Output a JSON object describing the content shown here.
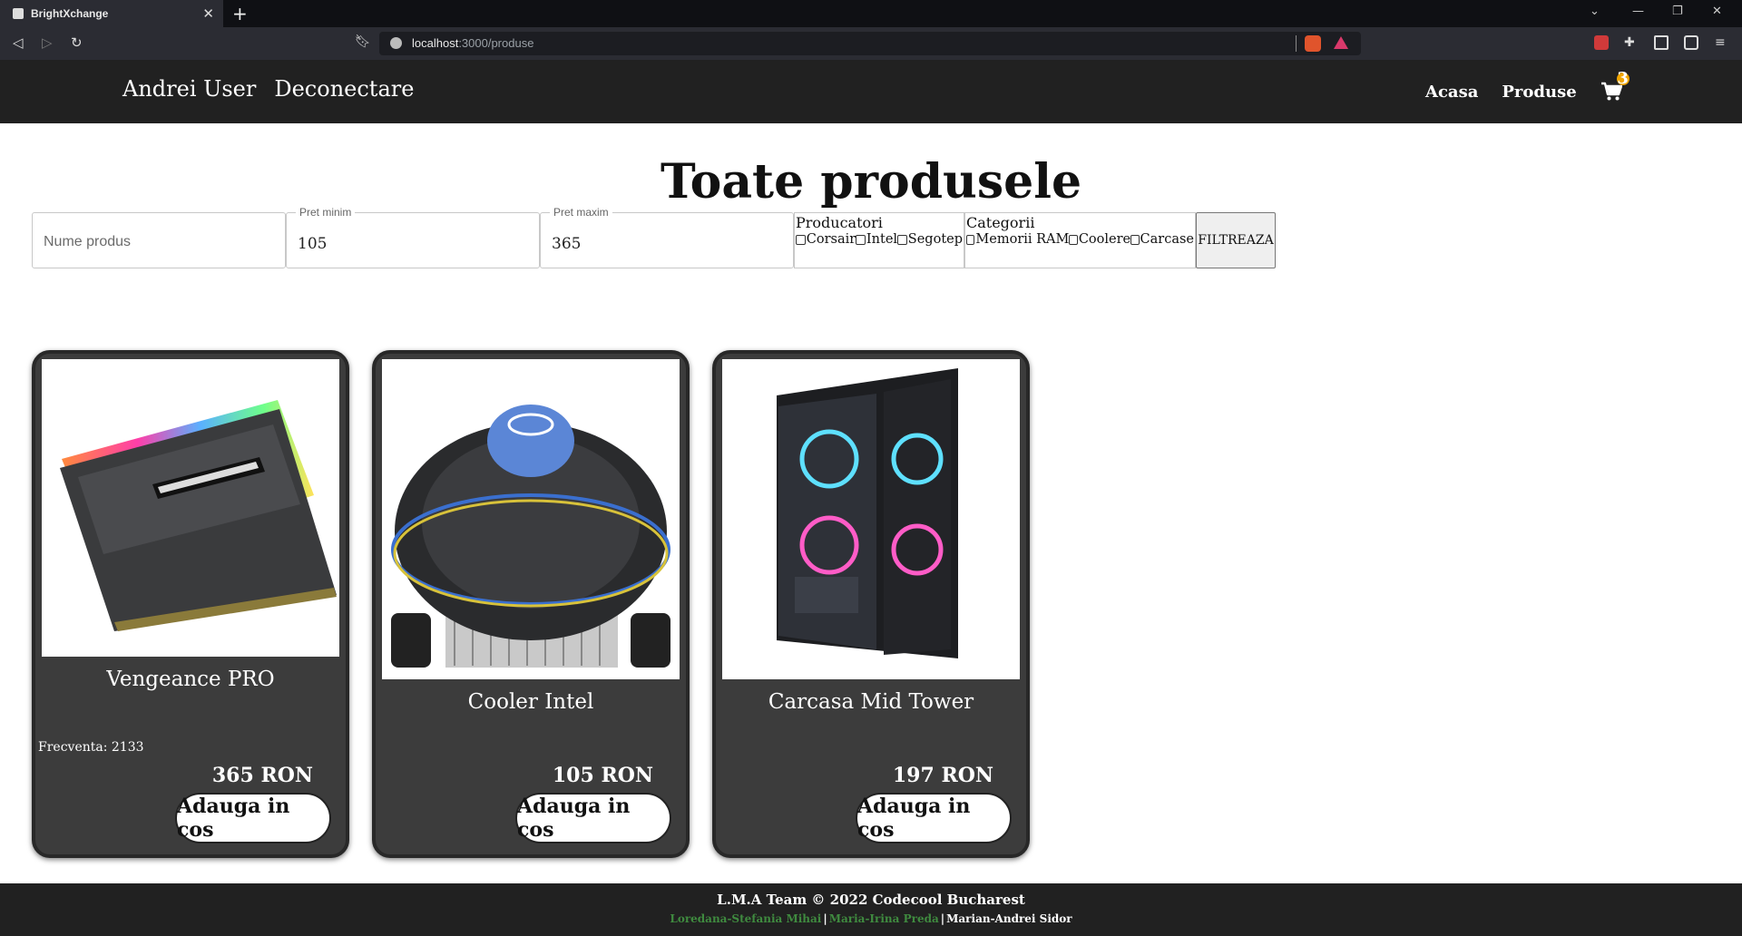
{
  "browser": {
    "tab_title": "BrightXchange",
    "url_host": "localhost",
    "url_path": ":3000/produse"
  },
  "nav": {
    "user": "Andrei User",
    "logout": "Deconectare",
    "home": "Acasa",
    "products": "Produse",
    "cart_count": "3"
  },
  "page_title": "Toate produsele",
  "filters": {
    "name_placeholder": "Nume produs",
    "min_label": "Pret minim",
    "min_value": "105",
    "max_label": "Pret maxim",
    "max_value": "365",
    "producers_label": "Producatori",
    "producers": [
      "Corsair",
      "Intel",
      "Segotep"
    ],
    "categories_label": "Categorii",
    "categories": [
      "Memorii RAM",
      "Coolere",
      "Carcase"
    ],
    "button": "FILTREAZA"
  },
  "products": [
    {
      "name": "Vengeance PRO",
      "spec": "Frecventa: 2133",
      "price": "365 RON",
      "add": "Adauga in cos",
      "image": "ram-module-icon"
    },
    {
      "name": "Cooler Intel",
      "spec": "",
      "price": "105 RON",
      "add": "Adauga in cos",
      "image": "cpu-cooler-icon"
    },
    {
      "name": "Carcasa Mid Tower",
      "spec": "",
      "price": "197 RON",
      "add": "Adauga in cos",
      "image": "pc-case-icon"
    }
  ],
  "footer": {
    "title": "L.M.A Team © 2022 Codecool Bucharest",
    "author1": "Loredana-Stefania Mihai",
    "author2": "Maria-Irina Preda",
    "author3": "Marian-Andrei Sidor",
    "separator": "|"
  }
}
